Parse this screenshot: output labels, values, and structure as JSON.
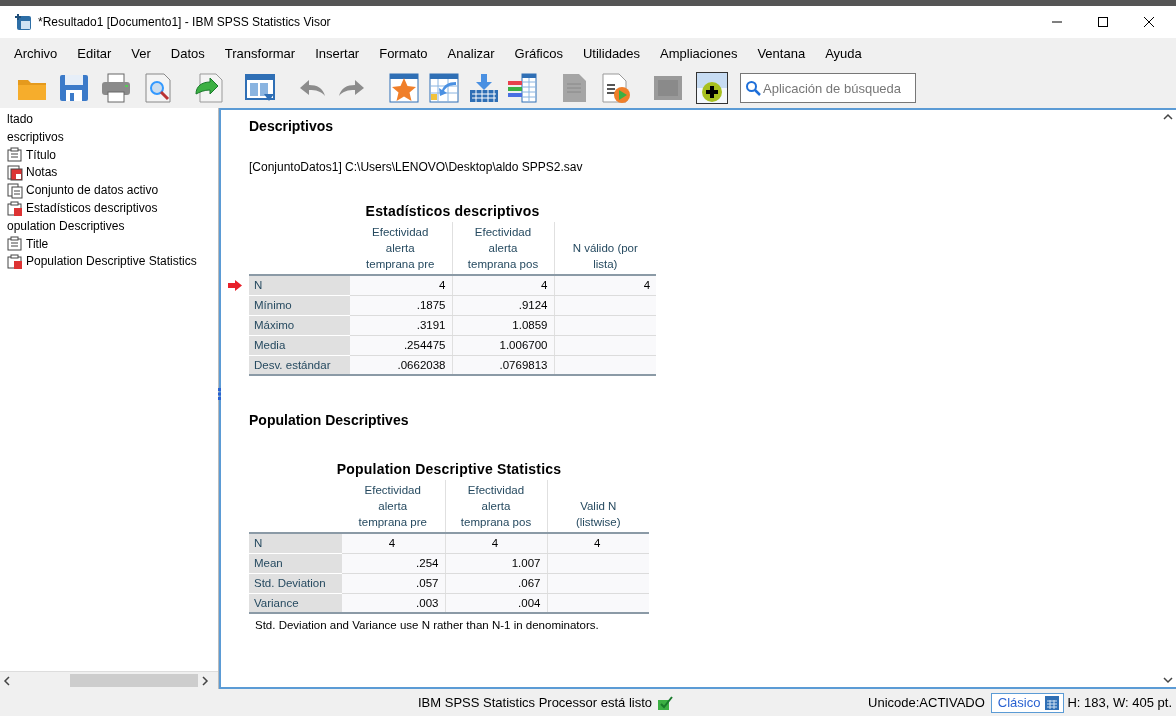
{
  "window": {
    "title": "*Resultado1 [Documento1] - IBM SPSS Statistics Visor"
  },
  "menu": [
    "Archivo",
    "Editar",
    "Ver",
    "Datos",
    "Transformar",
    "Insertar",
    "Formato",
    "Analizar",
    "Gráficos",
    "Utilidades",
    "Ampliaciones",
    "Ventana",
    "Ayuda"
  ],
  "search": {
    "placeholder": "Aplicación de búsqueda"
  },
  "outline": [
    {
      "label": "ltado",
      "children": [
        {
          "label": "escriptivos",
          "children": [
            {
              "label": "Título",
              "kind": "title"
            },
            {
              "label": "Notas",
              "kind": "notes"
            },
            {
              "label": "Conjunto de datos activo",
              "kind": "dataset"
            },
            {
              "label": "Estadísticos descriptivos",
              "kind": "table"
            }
          ]
        },
        {
          "label": "opulation Descriptives",
          "children": [
            {
              "label": "Title",
              "kind": "title"
            },
            {
              "label": "Population Descriptive Statistics",
              "kind": "table"
            }
          ]
        }
      ]
    }
  ],
  "viewer": [
    {
      "kind": "heading",
      "text": "Descriptivos"
    },
    {
      "kind": "note",
      "text": "[ConjuntoDatos1] C:\\Users\\LENOVO\\Desktop\\aldo SPPS2.sav"
    },
    {
      "kind": "table",
      "current": true,
      "title": "Estadísticos descriptivos",
      "columns": [
        "Efectividad alerta temprana pre",
        "Efectividad alerta temprana pos",
        "N válido (por lista)"
      ],
      "rows": [
        {
          "label": "N",
          "centered": false,
          "cells": [
            "4",
            "4",
            "4"
          ]
        },
        {
          "label": "Mínimo",
          "centered": false,
          "cells": [
            ".1875",
            ".9124",
            ""
          ]
        },
        {
          "label": "Máximo",
          "centered": false,
          "cells": [
            ".3191",
            "1.0859",
            ""
          ]
        },
        {
          "label": "Media",
          "centered": false,
          "cells": [
            ".254475",
            "1.006700",
            ""
          ]
        },
        {
          "label": "Desv. estándar",
          "centered": false,
          "cells": [
            ".0662038",
            ".0769813",
            ""
          ]
        }
      ]
    },
    {
      "kind": "heading",
      "text": "Population Descriptives"
    },
    {
      "kind": "table",
      "current": false,
      "title": "Population Descriptive Statistics",
      "columns": [
        "Efectividad alerta temprana pre",
        "Efectividad alerta temprana pos",
        "Valid N (listwise)"
      ],
      "rows": [
        {
          "label": "N",
          "centered": true,
          "cells": [
            "4",
            "4",
            "4"
          ]
        },
        {
          "label": "Mean",
          "centered": false,
          "cells": [
            ".254",
            "1.007",
            ""
          ]
        },
        {
          "label": "Std. Deviation",
          "centered": false,
          "cells": [
            ".057",
            ".067",
            ""
          ]
        },
        {
          "label": "Variance",
          "centered": false,
          "cells": [
            ".003",
            ".004",
            ""
          ]
        }
      ],
      "footnote": "Std. Deviation and Variance use N rather than N-1 in denominators."
    }
  ],
  "status_bar": {
    "message": "IBM SPSS Statistics Processor está listo",
    "encoding": "Unicode:ACTIVADO",
    "mode": "Clásico",
    "size": "H: 183, W: 405 pt."
  }
}
